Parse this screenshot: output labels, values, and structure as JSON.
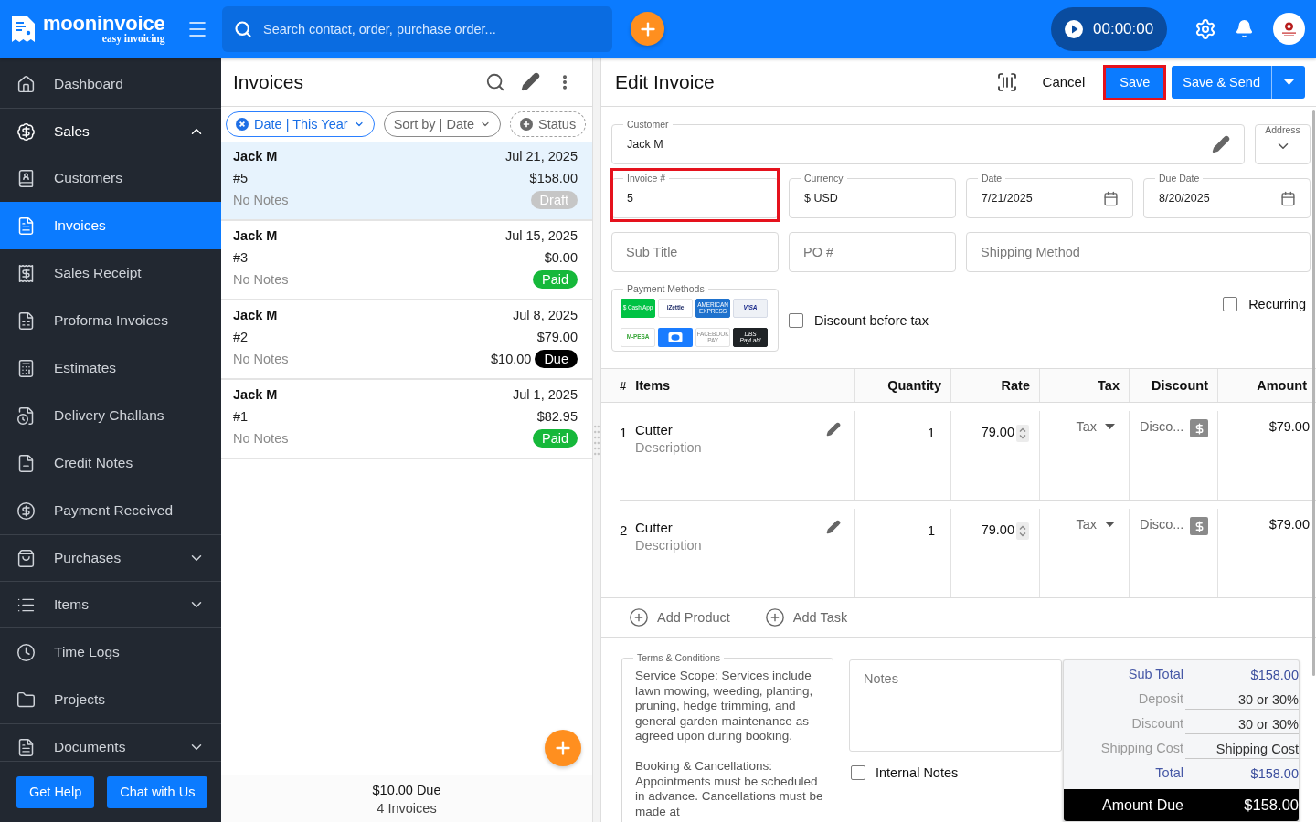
{
  "top_bar": {
    "logo": {
      "name": "mooninvoice",
      "tagline": "easy invoicing"
    },
    "search": {
      "placeholder": "Search contact, order, purchase order..."
    },
    "timer": {
      "time": "00:00:00",
      "running": false
    }
  },
  "sidebar": {
    "items": [
      {
        "label": "Dashboard",
        "kind": "link",
        "selected": false
      },
      {
        "label": "Sales",
        "kind": "group",
        "selected": false,
        "expanded": true,
        "children": [
          {
            "label": "Customers",
            "kind": "link",
            "selected": false
          },
          {
            "label": "Invoices",
            "kind": "link",
            "selected": true
          },
          {
            "label": "Sales Receipt",
            "kind": "link",
            "selected": false
          },
          {
            "label": "Proforma Invoices",
            "kind": "link",
            "selected": false
          },
          {
            "label": "Estimates",
            "kind": "link",
            "selected": false
          },
          {
            "label": "Delivery Challans",
            "kind": "link",
            "selected": false
          },
          {
            "label": "Credit Notes",
            "kind": "link",
            "selected": false
          },
          {
            "label": "Payment Received",
            "kind": "link",
            "selected": false
          }
        ]
      },
      {
        "label": "Purchases",
        "kind": "group",
        "selected": false,
        "expanded": false
      },
      {
        "label": "Items",
        "kind": "group",
        "selected": false,
        "expanded": false
      },
      {
        "label": "Time Logs",
        "kind": "link",
        "selected": false
      },
      {
        "label": "Projects",
        "kind": "link",
        "selected": false
      },
      {
        "label": "Documents",
        "kind": "group",
        "selected": false,
        "expanded": false
      }
    ],
    "buttons": [
      "Get Help",
      "Chat with Us"
    ]
  },
  "invoice_list": {
    "title": "Invoices",
    "chips": [
      {
        "label": "Date | This Year",
        "kind": "filter"
      },
      {
        "label": "Sort by | Date",
        "kind": "sort"
      },
      {
        "label": "Status",
        "kind": "add"
      }
    ],
    "invoices": [
      {
        "customer": "Jack M",
        "date": "Jul 21, 2025",
        "number": "#5",
        "amount": "$158.00",
        "notes": "No Notes",
        "status": {
          "label": "Draft",
          "kind": "draft"
        },
        "selected": true
      },
      {
        "customer": "Jack M",
        "date": "Jul 15, 2025",
        "number": "#3",
        "amount": "$0.00",
        "notes": "No Notes",
        "status": {
          "label": "Paid",
          "kind": "paid"
        },
        "selected": false
      },
      {
        "customer": "Jack M",
        "date": "Jul 8, 2025",
        "number": "#2",
        "amount": "$79.00",
        "notes": "No Notes",
        "due_amount": "$10.00",
        "status": {
          "label": "Due",
          "kind": "due"
        },
        "selected": false
      },
      {
        "customer": "Jack M",
        "date": "Jul 1, 2025",
        "number": "#1",
        "amount": "$82.95",
        "notes": "No Notes",
        "status": {
          "label": "Paid",
          "kind": "paid"
        },
        "selected": false
      }
    ],
    "footer": {
      "due": "$10.00 Due",
      "count": "4 Invoices"
    }
  },
  "edit_invoice": {
    "title": "Edit Invoice",
    "actions": [
      {
        "label": "Cancel",
        "kind": "text",
        "highlighted": false
      },
      {
        "label": "Save",
        "kind": "primary",
        "highlighted": true
      },
      {
        "label": "Save & Send",
        "kind": "split",
        "highlighted": false
      }
    ],
    "customer": {
      "label": "Customer",
      "value": "Jack M"
    },
    "address": {
      "label": "Address",
      "expanded": false
    },
    "details": [
      {
        "label": "Invoice #",
        "value": "5",
        "kind": "text",
        "highlighted": true
      },
      {
        "label": "Currency",
        "value": "$ USD",
        "kind": "text",
        "highlighted": false
      },
      {
        "label": "Date",
        "value": "7/21/2025",
        "kind": "date",
        "highlighted": false
      },
      {
        "label": "Due Date",
        "value": "8/20/2025",
        "kind": "date",
        "highlighted": false
      }
    ],
    "extras": [
      {
        "placeholder": "Sub Title"
      },
      {
        "placeholder": "PO #"
      },
      {
        "placeholder": "Shipping Method"
      }
    ],
    "payment_methods": {
      "label": "Payment Methods",
      "methods": [
        {
          "kind": "cashapp",
          "text": "$ Cash App"
        },
        {
          "kind": "izettle",
          "text": "iZettle"
        },
        {
          "kind": "amex",
          "text": "AMERICAN EXPRESS"
        },
        {
          "kind": "visa",
          "text": "VISA"
        },
        {
          "kind": "mpesa",
          "text": "M-PESA"
        },
        {
          "kind": "cash"
        },
        {
          "kind": "facebookpay",
          "text": "FACEBOOK PAY"
        },
        {
          "kind": "dbs",
          "text": "DBS PayLah!"
        }
      ]
    },
    "options": [
      {
        "label": "Discount before tax",
        "checked": false
      },
      {
        "label": "Recurring",
        "checked": false
      }
    ],
    "items_table": {
      "columns": [
        "#",
        "Items",
        "Quantity",
        "Rate",
        "Tax",
        "Discount",
        "Amount"
      ],
      "rows": [
        {
          "number": "1",
          "name": "Cutter",
          "description": {
            "placeholder": "Description"
          },
          "quantity": "1",
          "rate": "79.00",
          "tax": {
            "placeholder": "Tax"
          },
          "discount": {
            "placeholder": "Disco..."
          },
          "amount": "$79.00"
        },
        {
          "number": "2",
          "name": "Cutter",
          "description": {
            "placeholder": "Description"
          },
          "quantity": "1",
          "rate": "79.00",
          "tax": {
            "placeholder": "Tax"
          },
          "discount": {
            "placeholder": "Disco..."
          },
          "amount": "$79.00"
        }
      ]
    },
    "add_buttons": [
      "Add Product",
      "Add Task"
    ],
    "terms": {
      "label": "Terms & Conditions",
      "paragraphs": [
        "Service Scope: Services include lawn mowing, weeding, planting, pruning, hedge trimming, and general garden maintenance as agreed upon during booking.",
        "Booking & Cancellations: Appointments must be scheduled in advance. Cancellations must be made at"
      ]
    },
    "notes": {
      "placeholder": "Notes"
    },
    "internal_notes": {
      "label": "Internal Notes",
      "checked": false
    },
    "totals": {
      "rows": [
        {
          "label": "Sub Total",
          "value": "$158.00",
          "kind": "sum"
        },
        {
          "label": "Deposit",
          "value": "30 or 30%",
          "kind": "input"
        },
        {
          "label": "Discount",
          "value": "30 or 30%",
          "kind": "input"
        },
        {
          "label": "Shipping Cost",
          "value": "Shipping Cost",
          "kind": "input"
        },
        {
          "label": "Total",
          "value": "$158.00",
          "kind": "sum"
        }
      ],
      "amount_due": {
        "label": "Amount Due",
        "value": "$158.00"
      }
    }
  }
}
